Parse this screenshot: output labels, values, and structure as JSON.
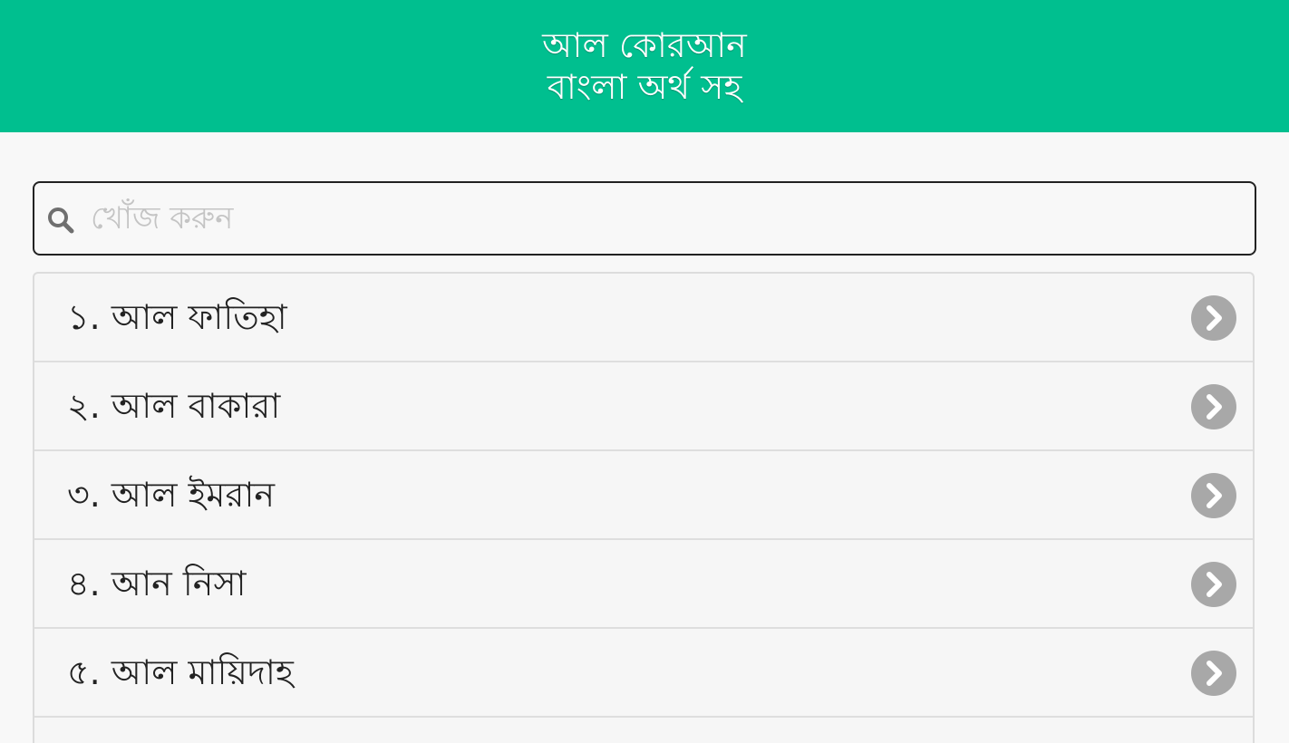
{
  "header": {
    "title_line1": "আল কোরআন",
    "title_line2": "বাংলা অর্থ সহ",
    "background": "#00bf8f"
  },
  "search": {
    "placeholder": "খোঁজ করুন",
    "value": "",
    "icon": "search-icon"
  },
  "surah_list": [
    {
      "label": "১. আল ফাতিহা",
      "icon": "chevron-right-icon"
    },
    {
      "label": "২. আল বাকারা",
      "icon": "chevron-right-icon"
    },
    {
      "label": "৩. আল ইমরান",
      "icon": "chevron-right-icon"
    },
    {
      "label": "৪. আন নিসা",
      "icon": "chevron-right-icon"
    },
    {
      "label": "৫. আল মায়িদাহ",
      "icon": "chevron-right-icon"
    }
  ]
}
